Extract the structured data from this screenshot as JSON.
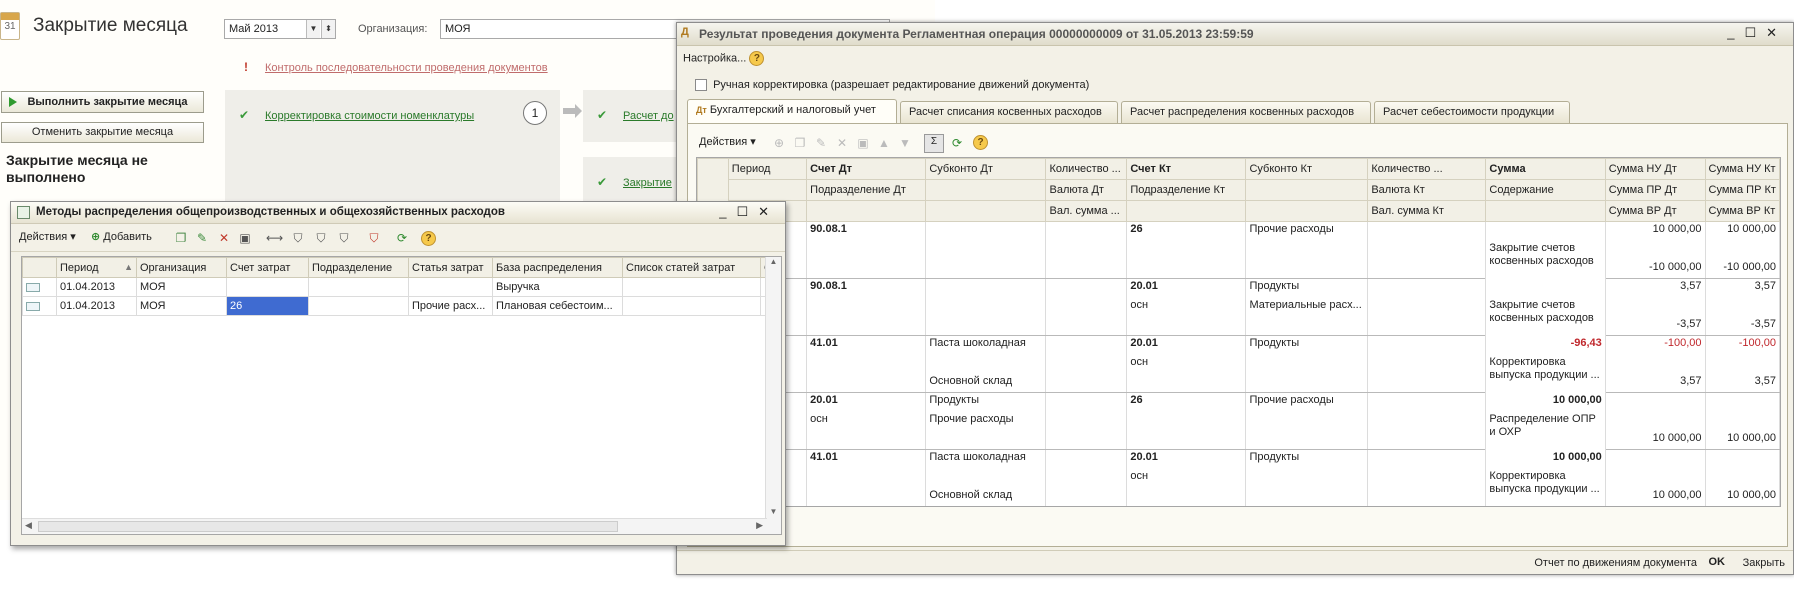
{
  "month_close": {
    "calendar_num": "31",
    "title": "Закрытие месяца",
    "period_value": "Май 2013",
    "org_label": "Организация:",
    "org_value": "МОЯ",
    "warning_mark": "!",
    "control_link": "Контроль последовательности проведения документов",
    "run_button": "Выполнить закрытие месяца",
    "cancel_button": "Отменить закрытие месяца",
    "status_text": "Закрытие месяца не выполнено",
    "step1_link": "Корректировка стоимости номенклатуры",
    "step_number": "1",
    "step2_link": "Расчет до",
    "step3_link": "Закрытие"
  },
  "methods_window": {
    "title": "Методы распределения общепроизводственных и общехозяйственных расходов",
    "actions_label": "Действия",
    "add_label": "Добавить",
    "columns": [
      "Период",
      "Организация",
      "Счет затрат",
      "Подразделение",
      "Статья затрат",
      "База распределения",
      "Список статей затрат",
      "С"
    ],
    "rows": [
      [
        "01.04.2013",
        "МОЯ",
        "",
        "",
        "",
        "Выручка",
        ""
      ],
      [
        "01.04.2013",
        "МОЯ",
        "26",
        "",
        "Прочие расх...",
        "Плановая себестоим...",
        ""
      ]
    ]
  },
  "result_window": {
    "title": "Результат проведения документа Регламентная операция 00000000009 от 31.05.2013 23:59:59",
    "settings_label": "Настройка...",
    "manual_correction_label": "Ручная корректировка (разрешает редактирование движений документа)",
    "tabs": [
      {
        "label": "Бухгалтерский и налоговый учет",
        "active": true
      },
      {
        "label": "Расчет списания косвенных расходов",
        "active": false
      },
      {
        "label": "Расчет распределения косвенных расходов",
        "active": false
      },
      {
        "label": "Расчет себестоимости продукции",
        "active": false
      }
    ],
    "actions_label": "Действия",
    "header_row1": [
      "Период",
      "Счет Дт",
      "Субконто Дт",
      "Количество ...",
      "Счет Кт",
      "Субконто Кт",
      "Количество ...",
      "Сумма",
      "Сумма НУ Дт",
      "Сумма НУ Кт"
    ],
    "header_row2": [
      "Подразделение Дт",
      "Валюта Дт",
      "Подразделение Кт",
      "Валюта Кт",
      "Содержание",
      "Сумма ПР Дт",
      "Сумма ПР Кт"
    ],
    "header_row3": [
      "Вал. сумма ...",
      "Вал. сумма Кт",
      "Сумма ВР Дт",
      "Сумма ВР Кт"
    ],
    "entries": [
      {
        "dt": "90.08.1",
        "dt_sub1": "",
        "dt_sub2": "",
        "dt_dept": "",
        "kt": "26",
        "kt_sub": "Прочие расходы",
        "kt_sub2": "",
        "kt_dept": "",
        "sum": "",
        "content": "Закрытие счетов косвенных расходов",
        "nu_dt": "10 000,00",
        "nu_kt": "10 000,00",
        "vr_dt": "-10 000,00",
        "vr_kt": "-10 000,00",
        "sum_red": false
      },
      {
        "dt": "90.08.1",
        "dt_sub1": "",
        "dt_sub2": "",
        "dt_dept": "",
        "kt": "20.01",
        "kt_sub": "Продукты",
        "kt_sub2": "Материальные расх...",
        "kt_dept": "осн",
        "sum": "",
        "content": "Закрытие счетов косвенных расходов",
        "nu_dt": "3,57",
        "nu_kt": "3,57",
        "vr_dt": "-3,57",
        "vr_kt": "-3,57",
        "sum_red": false
      },
      {
        "dt": "41.01",
        "dt_sub1": "Паста шоколадная",
        "dt_sub2": "Основной склад",
        "dt_dept": "",
        "kt": "20.01",
        "kt_sub": "Продукты",
        "kt_sub2": "",
        "kt_dept": "осн",
        "sum": "-96,43",
        "content": "Корректировка выпуска продукции ...",
        "nu_dt": "-100,00",
        "nu_kt": "-100,00",
        "vr_dt": "3,57",
        "vr_kt": "3,57",
        "sum_red": true
      },
      {
        "dt": "20.01",
        "dt_sub1": "Продукты",
        "dt_sub2": "Прочие расходы",
        "dt_dept": "осн",
        "kt": "26",
        "kt_sub": "Прочие расходы",
        "kt_sub2": "",
        "kt_dept": "",
        "sum": "10 000,00",
        "content": "Распределение ОПР и ОХР",
        "nu_dt": "",
        "nu_kt": "",
        "vr_dt": "10 000,00",
        "vr_kt": "10 000,00",
        "sum_red": false
      },
      {
        "dt": "41.01",
        "dt_sub1": "Паста шоколадная",
        "dt_sub2": "Основной склад",
        "dt_dept": "",
        "kt": "20.01",
        "kt_sub": "Продукты",
        "kt_sub2": "",
        "kt_dept": "осн",
        "sum": "10 000,00",
        "content": "Корректировка выпуска продукции ...",
        "nu_dt": "",
        "nu_kt": "",
        "vr_dt": "10 000,00",
        "vr_kt": "10 000,00",
        "sum_red": false
      }
    ],
    "status_report_link": "Отчет по движениям документа",
    "ok_button": "OK",
    "close_button": "Закрыть"
  },
  "colors": {
    "accent_green": "#2a7a2a",
    "negative_red": "#c0282d",
    "selection": "#3f6bd1"
  }
}
